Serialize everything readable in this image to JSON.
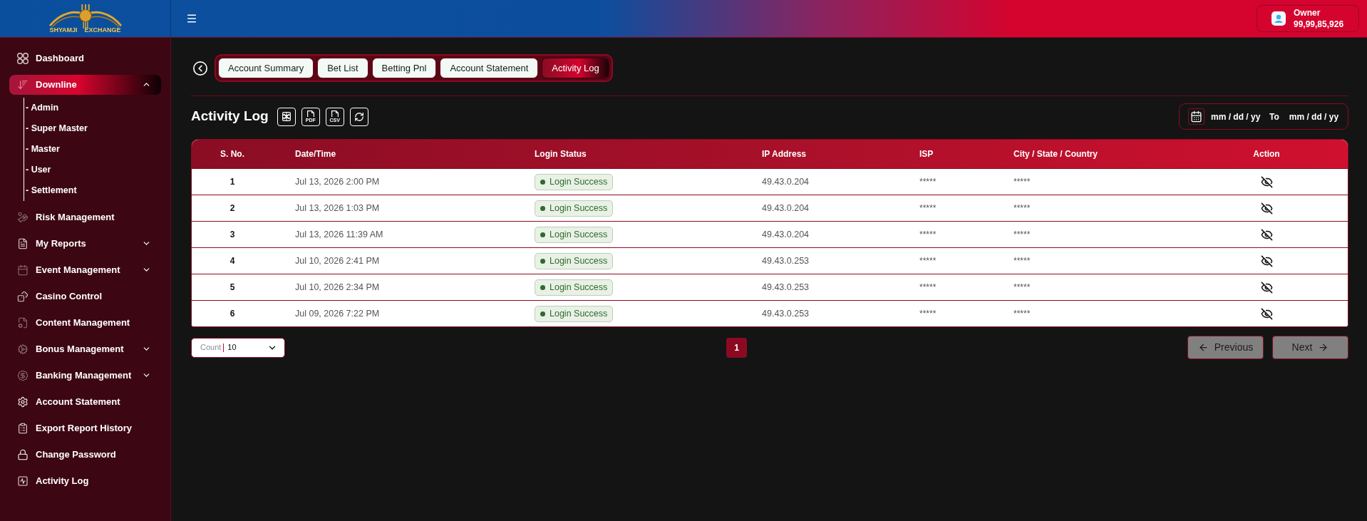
{
  "header": {
    "logo": {
      "left_text": "SHYAMJI",
      "right_text": "EXCHANGE"
    },
    "account": {
      "role": "Owner",
      "balance": "99,99,85,926"
    }
  },
  "sidebar": {
    "items": [
      {
        "label": "Dashboard",
        "selected": false
      },
      {
        "label": "Downline",
        "selected": true,
        "expanded": true,
        "children": [
          {
            "label": "- Admin",
            "selected": false
          },
          {
            "label": "- Super Master",
            "selected": false
          },
          {
            "label": "- Master",
            "selected": false
          },
          {
            "label": "- User",
            "selected": false
          },
          {
            "label": "- Settlement",
            "selected": false
          }
        ]
      },
      {
        "label": "Risk Management",
        "selected": false
      },
      {
        "label": "My Reports",
        "selected": false,
        "expanded": false
      },
      {
        "label": "Event Management",
        "selected": false,
        "expanded": false
      },
      {
        "label": "Casino Control",
        "selected": false
      },
      {
        "label": "Content Management",
        "selected": false
      },
      {
        "label": "Bonus Management",
        "selected": false,
        "expanded": false
      },
      {
        "label": "Banking Management",
        "selected": false,
        "expanded": false
      },
      {
        "label": "Account Statement",
        "selected": false
      },
      {
        "label": "Export Report History",
        "selected": false
      },
      {
        "label": "Change Password",
        "selected": false
      },
      {
        "label": "Activity Log",
        "selected": false
      }
    ]
  },
  "page": {
    "tabs": [
      {
        "label": "Account Summary",
        "selected": false
      },
      {
        "label": "Bet List",
        "selected": false
      },
      {
        "label": "Betting Pnl",
        "selected": false
      },
      {
        "label": "Account Statement",
        "selected": false
      },
      {
        "label": "Activity Log",
        "selected": true
      }
    ],
    "title": "Activity Log",
    "export_buttons": [
      {
        "kind": "excel"
      },
      {
        "kind": "pdf",
        "label": "PDF"
      },
      {
        "kind": "csv",
        "label": "CSV"
      },
      {
        "kind": "refresh"
      }
    ],
    "date_range": {
      "from": {
        "placeholder": "mm / dd / yy"
      },
      "separator": "To",
      "to": {
        "placeholder": "mm / dd / yy"
      }
    }
  },
  "table": {
    "columns": [
      "S. No.",
      "Date/Time",
      "Login Status",
      "IP Address",
      "ISP",
      "City / State / Country",
      "Action"
    ],
    "rows": [
      {
        "s_no": "1",
        "date_time": "Jul 13, 2026 2:00 PM",
        "login_status": "Login Success",
        "ip_address": "49.43.0.204",
        "isp": "*****",
        "location": "*****"
      },
      {
        "s_no": "2",
        "date_time": "Jul 13, 2026 1:03 PM",
        "login_status": "Login Success",
        "ip_address": "49.43.0.204",
        "isp": "*****",
        "location": "*****"
      },
      {
        "s_no": "3",
        "date_time": "Jul 13, 2026 11:39 AM",
        "login_status": "Login Success",
        "ip_address": "49.43.0.204",
        "isp": "*****",
        "location": "*****"
      },
      {
        "s_no": "4",
        "date_time": "Jul 10, 2026 2:41 PM",
        "login_status": "Login Success",
        "ip_address": "49.43.0.253",
        "isp": "*****",
        "location": "*****"
      },
      {
        "s_no": "5",
        "date_time": "Jul 10, 2026 2:34 PM",
        "login_status": "Login Success",
        "ip_address": "49.43.0.253",
        "isp": "*****",
        "location": "*****"
      },
      {
        "s_no": "6",
        "date_time": "Jul 09, 2026 7:22 PM",
        "login_status": "Login Success",
        "ip_address": "49.43.0.253",
        "isp": "*****",
        "location": "*****"
      }
    ]
  },
  "footer": {
    "count": {
      "label": "Count",
      "value": "10"
    },
    "pages": [
      {
        "label": "1",
        "selected": true
      }
    ],
    "previous": {
      "label": "Previous",
      "disabled": true
    },
    "next": {
      "label": "Next",
      "disabled": true
    }
  }
}
